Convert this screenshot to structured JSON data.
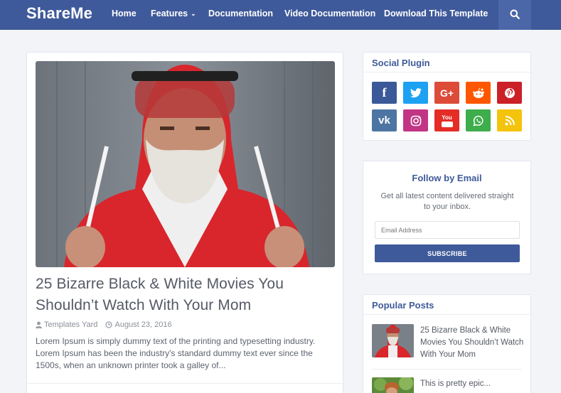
{
  "header": {
    "brand": "ShareMe",
    "nav": [
      {
        "label": "Home"
      },
      {
        "label": "Features",
        "dropdown": true
      },
      {
        "label": "Documentation"
      },
      {
        "label": "Video Documentation"
      },
      {
        "label": "Download This Template"
      }
    ],
    "search_icon": "search-icon"
  },
  "post": {
    "title": "25 Bizarre Black & White Movies You Shouldn’t Watch With Your Mom",
    "author": "Templates Yard",
    "date": "August 23, 2016",
    "excerpt": "Lorem Ipsum is simply dummy text of the printing and typesetting industry. Lorem Ipsum has been the industry's standard dummy text ever since the 1500s, when an unknown printer took a galley of..."
  },
  "sidebar": {
    "social": {
      "title": "Social Plugin",
      "items": [
        {
          "name": "facebook",
          "glyph": "f",
          "color": "#3b5998"
        },
        {
          "name": "twitter",
          "glyph": "",
          "color": "#1da1f2"
        },
        {
          "name": "google-plus",
          "glyph": "G+",
          "color": "#dd4b39"
        },
        {
          "name": "reddit",
          "glyph": "",
          "color": "#ff5700"
        },
        {
          "name": "pinterest",
          "glyph": "",
          "color": "#cb2027"
        },
        {
          "name": "vk",
          "glyph": "vk",
          "color": "#4c75a3"
        },
        {
          "name": "instagram",
          "glyph": "",
          "color": "#c13584"
        },
        {
          "name": "youtube",
          "glyph": "You",
          "color": "#e52d27"
        },
        {
          "name": "whatsapp",
          "glyph": "",
          "color": "#3ead4b"
        },
        {
          "name": "rss",
          "glyph": "",
          "color": "#f4c30c"
        }
      ]
    },
    "follow": {
      "title": "Follow by Email",
      "description": "Get all latest content delivered straight to your inbox.",
      "email_placeholder": "Email Address",
      "button": "SUBSCRIBE"
    },
    "popular": {
      "title": "Popular Posts",
      "items": [
        {
          "title": "25 Bizarre Black & White Movies You Shouldn’t Watch With Your Mom"
        },
        {
          "title": "This is pretty epic..."
        }
      ]
    }
  },
  "colors": {
    "primary": "#3f5a9a",
    "background": "#f3f4f8"
  }
}
